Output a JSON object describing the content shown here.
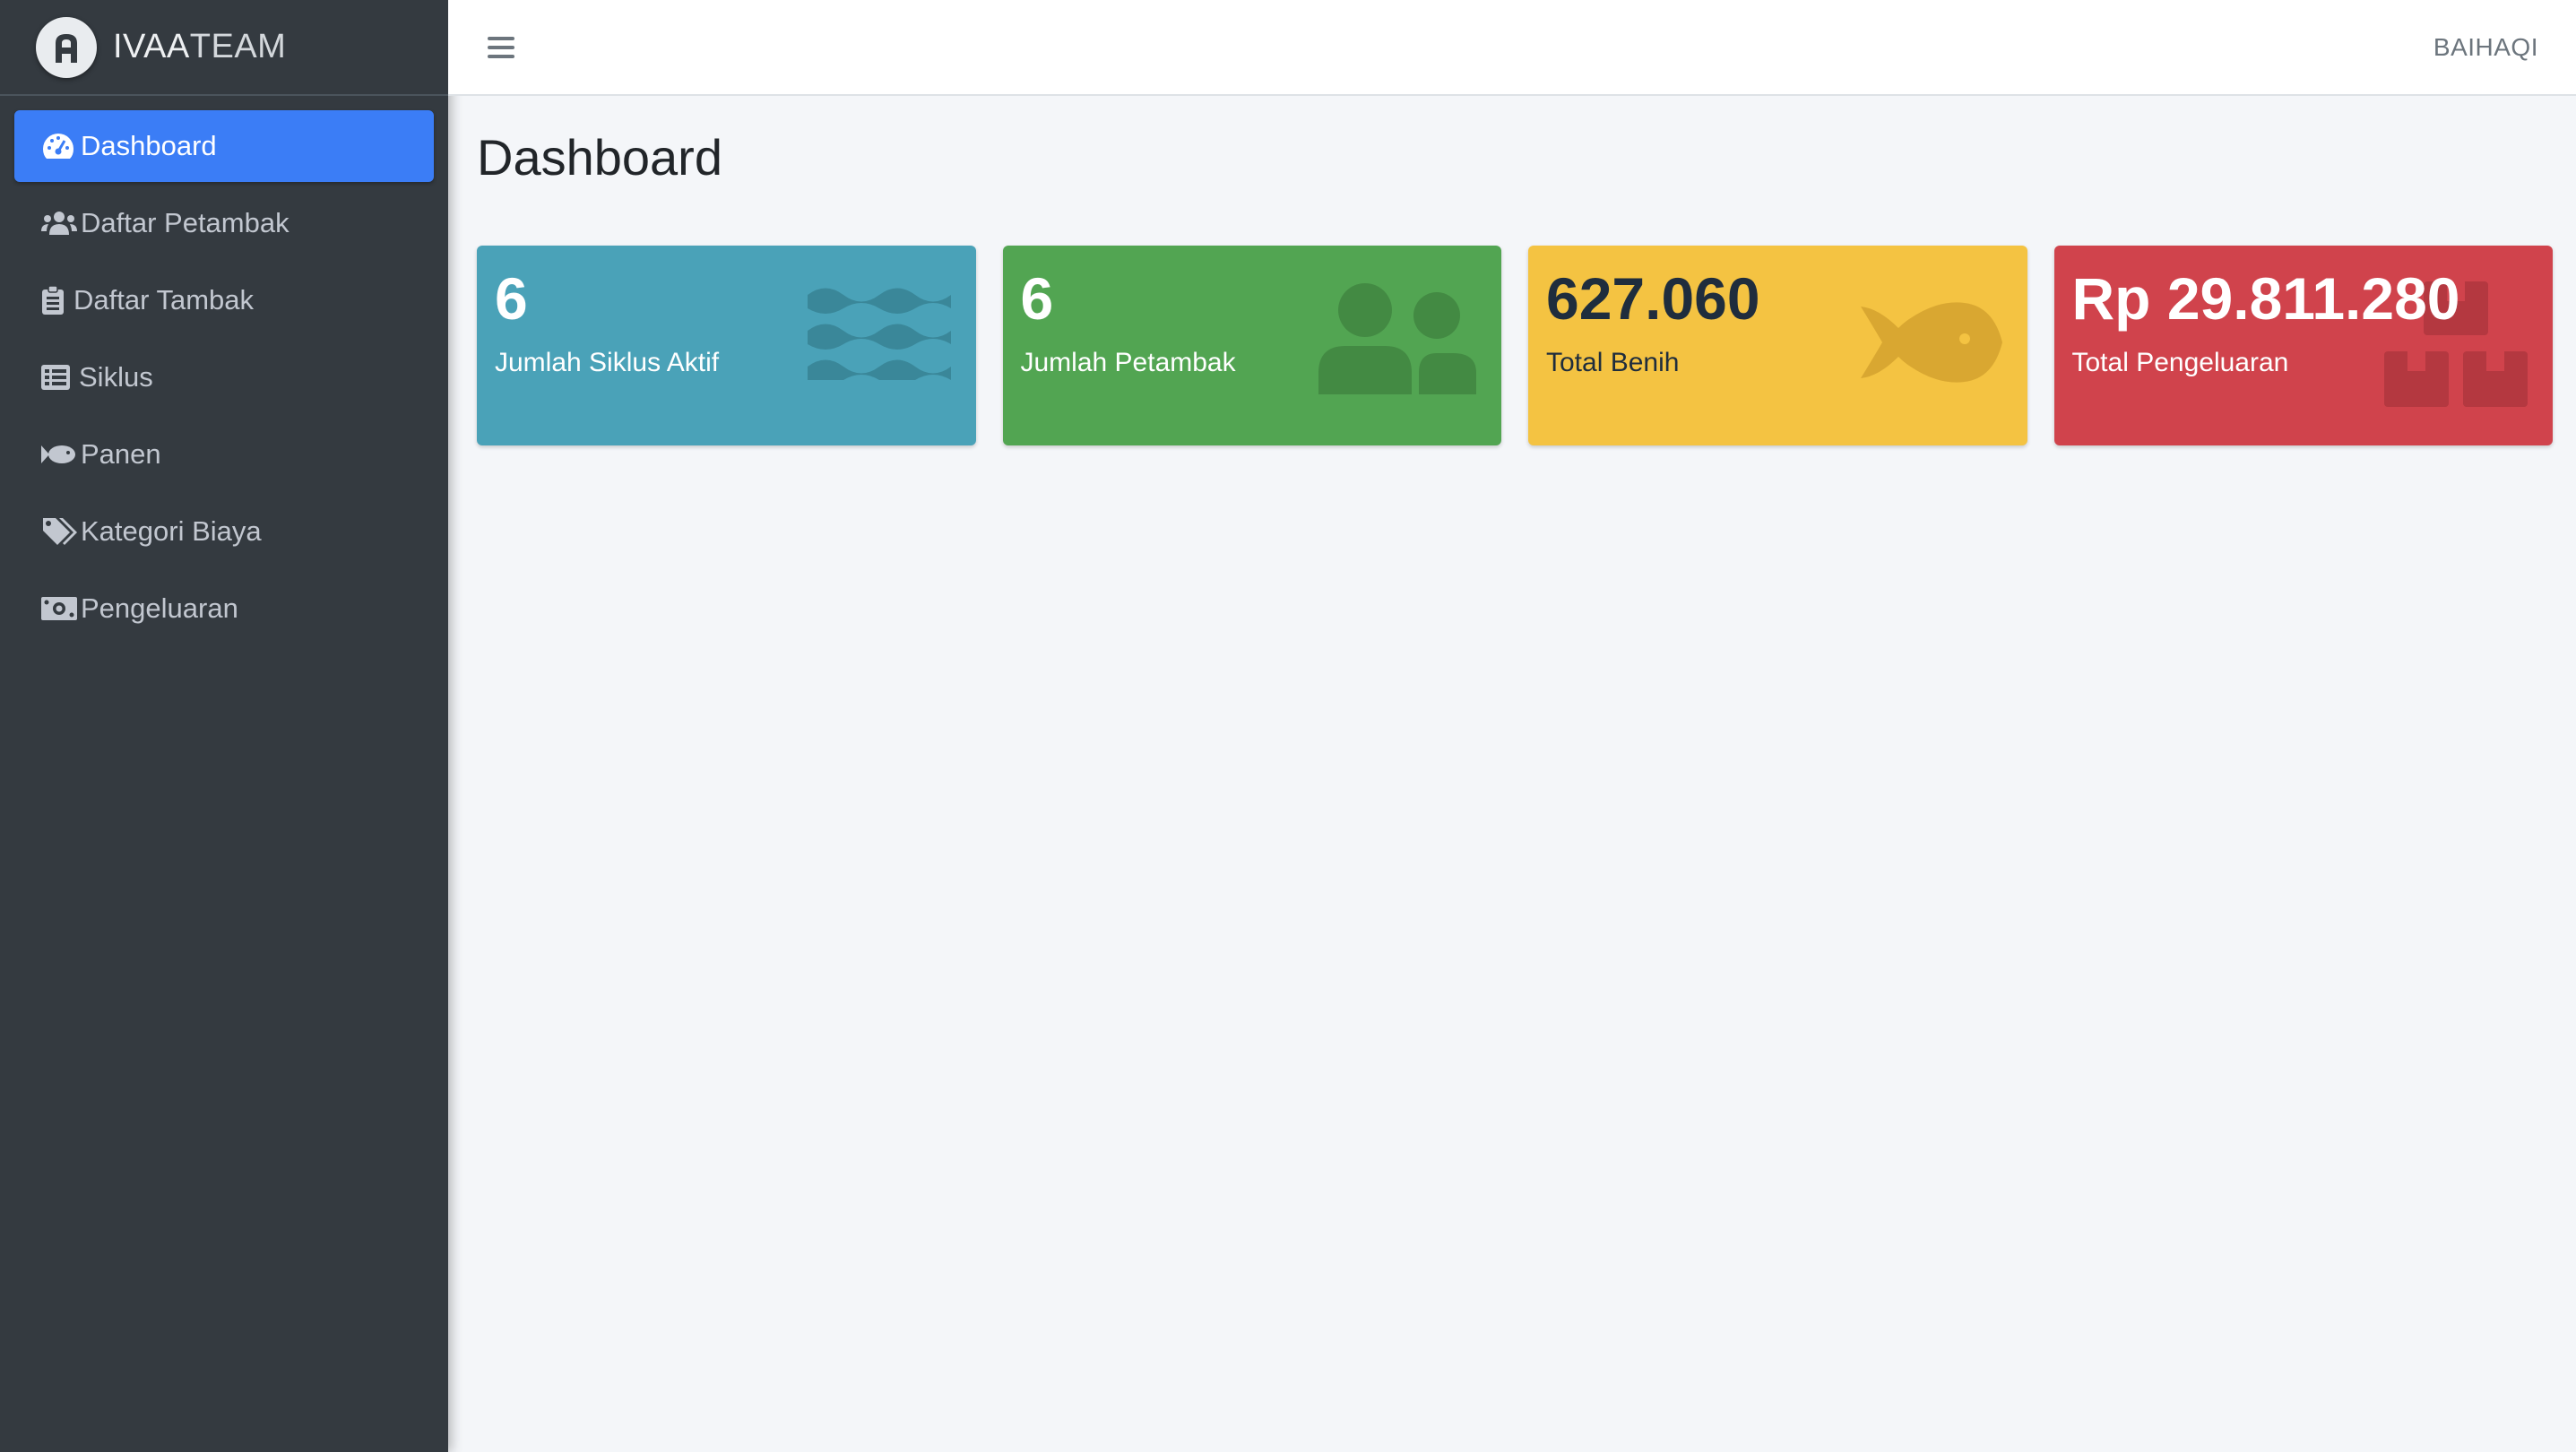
{
  "brand": {
    "name_bold": "IVAA",
    "name_light": "TEAM",
    "logo_letter": "A"
  },
  "sidebar": {
    "items": [
      {
        "label": "Dashboard",
        "icon": "gauge-icon",
        "active": true
      },
      {
        "label": "Daftar Petambak",
        "icon": "users-icon"
      },
      {
        "label": "Daftar Tambak",
        "icon": "clipboard-icon"
      },
      {
        "label": "Siklus",
        "icon": "list-icon"
      },
      {
        "label": "Panen",
        "icon": "fish-icon"
      },
      {
        "label": "Kategori Biaya",
        "icon": "tags-icon"
      },
      {
        "label": "Pengeluaran",
        "icon": "money-icon"
      }
    ]
  },
  "topbar": {
    "menu_icon": "hamburger-icon",
    "user_name": "BAIHAQI"
  },
  "page": {
    "title": "Dashboard"
  },
  "cards": [
    {
      "value": "6",
      "label": "Jumlah Siklus Aktif",
      "icon": "water-icon",
      "color": "#4aa2b8"
    },
    {
      "value": "6",
      "label": "Jumlah Petambak",
      "icon": "users-icon",
      "color": "#52a552"
    },
    {
      "value": "627.060",
      "label": "Total Benih",
      "icon": "fish-icon",
      "color": "#f4c342"
    },
    {
      "value": "Rp 29.811.280",
      "label": "Total Pengeluaran",
      "icon": "boxes-icon",
      "color": "#d0434c"
    }
  ],
  "colors": {
    "sidebar_bg": "#343a40",
    "active_nav": "#3b7df6",
    "content_bg": "#f4f6f9"
  }
}
